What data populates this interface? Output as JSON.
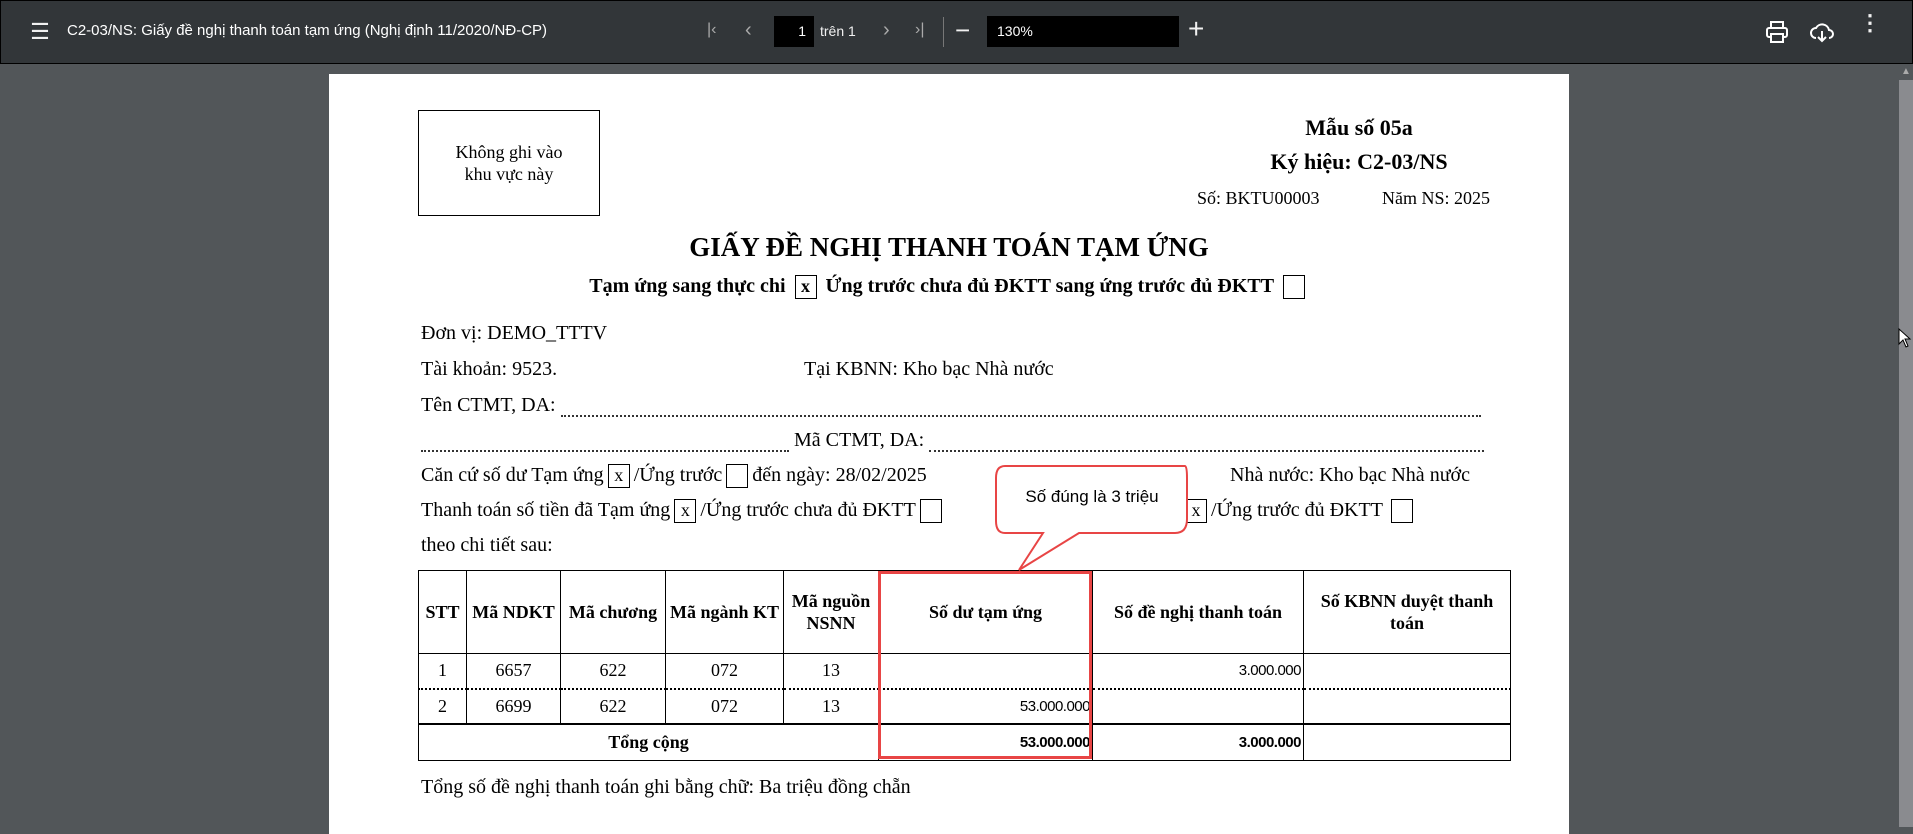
{
  "toolbar": {
    "title": "C2-03/NS: Giấy đề nghị thanh toán tạm ứng (Nghị định 11/2020/NĐ-CP)",
    "page": "1",
    "page_of": "trên 1",
    "zoom": "130%"
  },
  "doc": {
    "nowrite_box": [
      "Không ghi vào",
      "khu vực này"
    ],
    "form_no": "Mẫu số 05a",
    "symbol": "Ký hiệu: C2-03/NS",
    "number": "Số: BKTU00003",
    "year": "Năm NS: 2025",
    "title": "GIẤY ĐỀ NGHỊ THANH TOÁN TẠM ỨNG",
    "sub1": "Tạm ứng sang thực chi",
    "sub1_check": "x",
    "sub2": "Ứng trước chưa đủ ĐKTT sang ứng trước đủ ĐKTT",
    "sub2_check": "",
    "unit": "Đơn vị: DEMO_TTTV",
    "account": "Tài khoản: 9523.",
    "kbnn": "Tại KBNN: Kho bạc Nhà nước",
    "ctmt_name": "Tên CTMT, DA:",
    "ctmt_code": "Mã CTMT, DA:",
    "basis_a": "Căn cứ số dư Tạm ứng",
    "basis_check1": "x",
    "basis_b": "/Ứng trước",
    "basis_c": "đến ngày: 28/02/2025",
    "basis_d": "Nhà nước: Kho bạc Nhà nước",
    "pay_a": "Thanh toán số tiền đã Tạm ứng",
    "pay_check1": "x",
    "pay_b": "/Ứng trước chưa đủ ĐKTT",
    "pay_check3": "x",
    "pay_c": "/Ứng trước đủ ĐKTT",
    "detail": "theo chi tiết sau:",
    "footer": "Tổng số đề nghị thanh toán ghi bằng chữ: Ba triệu đồng chẵn"
  },
  "table": {
    "headers": [
      "STT",
      "Mã NDKT",
      "Mã chương",
      "Mã ngành KT",
      "Mã nguồn NSNN",
      "Số dư tạm ứng",
      "Số đề nghị thanh toán",
      "Số KBNN duyệt thanh toán"
    ],
    "rows": [
      [
        "1",
        "6657",
        "622",
        "072",
        "13",
        "",
        "3.000.000",
        ""
      ],
      [
        "2",
        "6699",
        "622",
        "072",
        "13",
        "53.000.000",
        "",
        ""
      ]
    ],
    "total": {
      "label": "Tổng cộng",
      "balance": "53.000.000",
      "requested": "3.000.000",
      "approved": ""
    }
  },
  "callout": {
    "text": "Số đúng là 3 triệu",
    "color": "#e84545"
  }
}
